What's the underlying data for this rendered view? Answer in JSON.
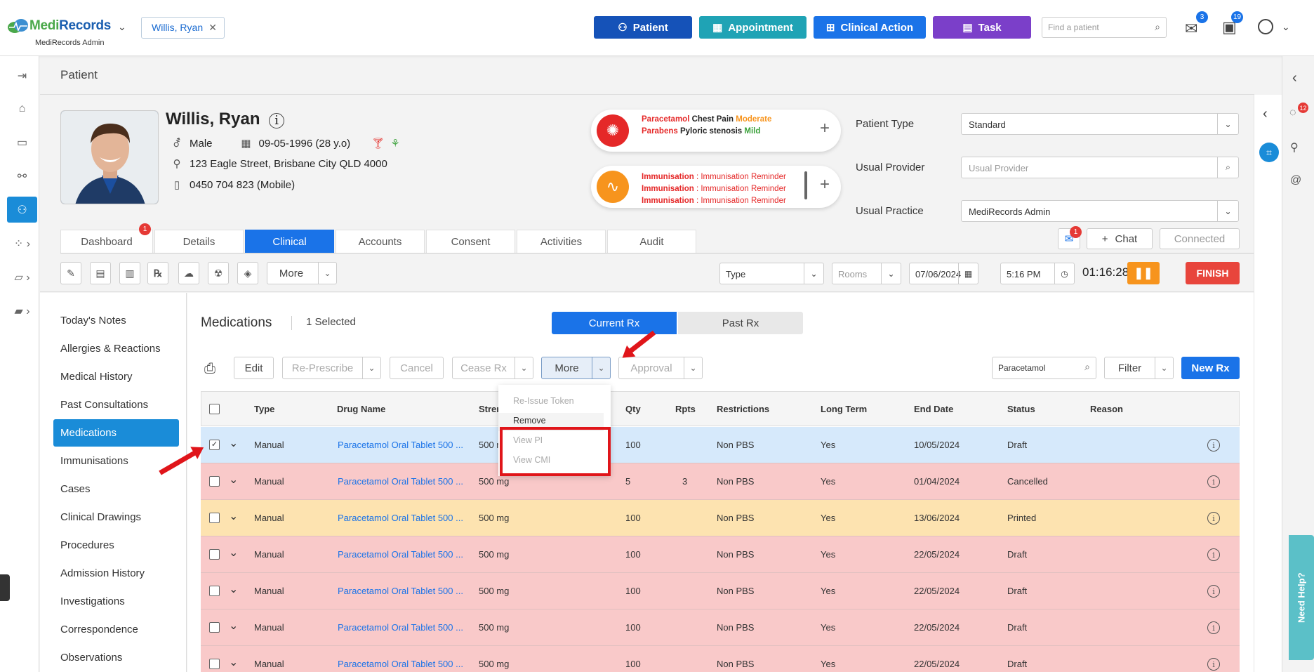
{
  "app": {
    "brand_medi": "Medi",
    "brand_records": "Records",
    "subtitle": "MediRecords Admin"
  },
  "patient_chip": "Willis, Ryan",
  "top_buttons": {
    "patient": "Patient",
    "appointment": "Appointment",
    "clinical_action": "Clinical Action",
    "task": "Task"
  },
  "top_search": {
    "placeholder": "Find a patient"
  },
  "badges": {
    "mail": "3",
    "tasks": "19",
    "right_notifications": "12",
    "dashboard": "1",
    "message": "1"
  },
  "page_title": "Patient",
  "patient": {
    "name": "Willis, Ryan",
    "gender": "Male",
    "dob": "09-05-1996 (28 y.o)",
    "address": "123 Eagle Street, Brisbane City QLD 4000",
    "phone": "0450 704 823 (Mobile)"
  },
  "allergies": [
    {
      "substance": "Paracetamol",
      "reaction": "Chest Pain",
      "severity": "Moderate"
    },
    {
      "substance": "Parabens",
      "reaction": "Pyloric stenosis",
      "severity": "Mild"
    }
  ],
  "reminders": [
    {
      "type": "Immunisation",
      "text": ": Immunisation Reminder"
    },
    {
      "type": "Immunisation",
      "text": ": Immunisation Reminder"
    },
    {
      "type": "Immunisation",
      "text": ": Immunisation Reminder"
    }
  ],
  "fields": {
    "patient_type_label": "Patient Type",
    "patient_type_value": "Standard",
    "usual_provider_label": "Usual Provider",
    "usual_provider_placeholder": "Usual Provider",
    "usual_practice_label": "Usual Practice",
    "usual_practice_value": "MediRecords Admin"
  },
  "tabs": [
    "Dashboard",
    "Details",
    "Clinical",
    "Accounts",
    "Consent",
    "Activities",
    "Audit"
  ],
  "chat": {
    "chat_label": "Chat",
    "connected_label": "Connected"
  },
  "toolbar": {
    "more": "More",
    "type_placeholder": "Type",
    "rooms_placeholder": "Rooms",
    "date": "07/06/2024",
    "time": "5:16 PM",
    "timer": "01:16:28",
    "finish": "FINISH"
  },
  "subnav": [
    "Today's Notes",
    "Allergies & Reactions",
    "Medical History",
    "Past Consultations",
    "Medications",
    "Immunisations",
    "Cases",
    "Clinical Drawings",
    "Procedures",
    "Admission History",
    "Investigations",
    "Correspondence",
    "Observations"
  ],
  "medications": {
    "title": "Medications",
    "selected": "1 Selected",
    "current_rx": "Current Rx",
    "past_rx": "Past Rx",
    "actions": {
      "edit": "Edit",
      "represcribe": "Re-Prescribe",
      "cancel": "Cancel",
      "cease": "Cease Rx",
      "more": "More",
      "approval": "Approval",
      "filter": "Filter",
      "new_rx": "New Rx"
    },
    "search_value": "Paracetamol",
    "more_menu": [
      "Re-Issue Token",
      "Remove",
      "View PI",
      "View CMI"
    ],
    "columns": [
      "Type",
      "Drug Name",
      "Strength",
      "Qty",
      "Rpts",
      "Restrictions",
      "Long Term",
      "End Date",
      "Status",
      "Reason"
    ],
    "rows": [
      {
        "type": "Manual",
        "drug": "Paracetamol Oral Tablet 500 ...",
        "strength": "500 mg",
        "qty": "100",
        "rpts": "",
        "restrictions": "Non PBS",
        "long_term": "Yes",
        "end_date": "10/05/2024",
        "status": "Draft",
        "color": "#d6e9fb"
      },
      {
        "type": "Manual",
        "drug": "Paracetamol Oral Tablet 500 ...",
        "strength": "500 mg",
        "qty": "5",
        "rpts": "3",
        "restrictions": "Non PBS",
        "long_term": "Yes",
        "end_date": "01/04/2024",
        "status": "Cancelled",
        "color": "#f9c9c9"
      },
      {
        "type": "Manual",
        "drug": "Paracetamol Oral Tablet 500 ...",
        "strength": "500 mg",
        "qty": "100",
        "rpts": "",
        "restrictions": "Non PBS",
        "long_term": "Yes",
        "end_date": "13/06/2024",
        "status": "Printed",
        "color": "#fde3b0"
      },
      {
        "type": "Manual",
        "drug": "Paracetamol Oral Tablet 500 ...",
        "strength": "500 mg",
        "qty": "100",
        "rpts": "",
        "restrictions": "Non PBS",
        "long_term": "Yes",
        "end_date": "22/05/2024",
        "status": "Draft",
        "color": "#f9c9c9"
      },
      {
        "type": "Manual",
        "drug": "Paracetamol Oral Tablet 500 ...",
        "strength": "500 mg",
        "qty": "100",
        "rpts": "",
        "restrictions": "Non PBS",
        "long_term": "Yes",
        "end_date": "22/05/2024",
        "status": "Draft",
        "color": "#f9c9c9"
      },
      {
        "type": "Manual",
        "drug": "Paracetamol Oral Tablet 500 ...",
        "strength": "500 mg",
        "qty": "100",
        "rpts": "",
        "restrictions": "Non PBS",
        "long_term": "Yes",
        "end_date": "22/05/2024",
        "status": "Draft",
        "color": "#f9c9c9"
      },
      {
        "type": "Manual",
        "drug": "Paracetamol Oral Tablet 500 ...",
        "strength": "500 mg",
        "qty": "100",
        "rpts": "",
        "restrictions": "Non PBS",
        "long_term": "Yes",
        "end_date": "22/05/2024",
        "status": "Draft",
        "color": "#f9c9c9"
      }
    ]
  },
  "need_help": "Need Help?",
  "colors": {
    "primary": "#1a73e8",
    "teal": "#1fa3b5",
    "task": "#7b3fc9",
    "dark_blue": "#1552b8",
    "finish": "#e8453c",
    "pause": "#f7941d",
    "annotation": "#e0151a"
  }
}
